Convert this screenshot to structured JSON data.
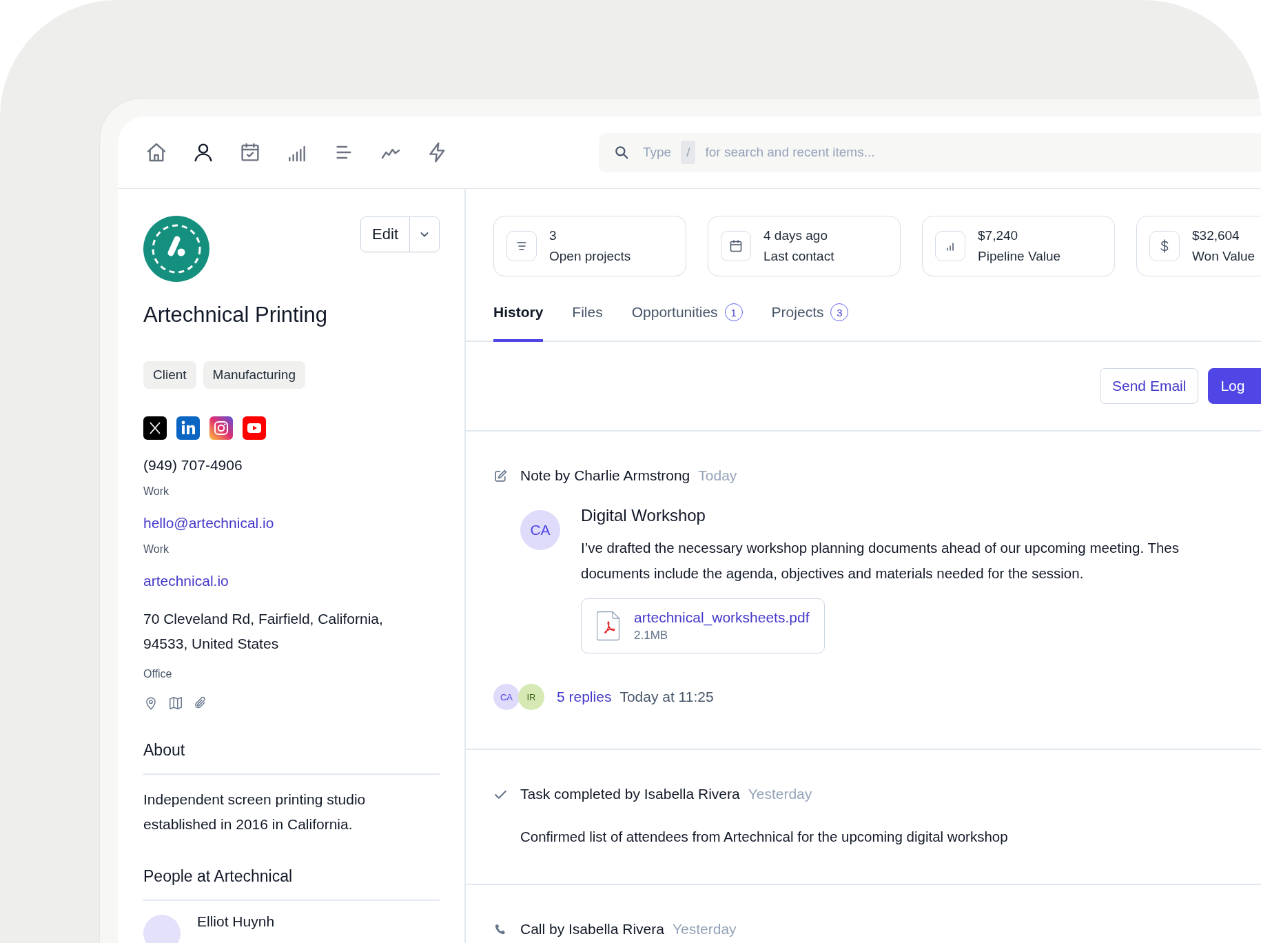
{
  "nav": {
    "items": [
      {
        "kind": "home",
        "selected": false
      },
      {
        "kind": "person",
        "selected": true
      },
      {
        "kind": "calendar",
        "selected": false
      },
      {
        "kind": "bars",
        "selected": false
      },
      {
        "kind": "lines",
        "selected": false
      },
      {
        "kind": "trend",
        "selected": false
      },
      {
        "kind": "bolt",
        "selected": false
      }
    ]
  },
  "search": {
    "hint": "Type",
    "shortcut": "/",
    "placeholder": "for search and recent items..."
  },
  "company": {
    "name": "Artechnical Printing",
    "edit_label": "Edit",
    "tags": [
      "Client",
      "Manufacturing"
    ],
    "social": [
      {
        "kind": "x"
      },
      {
        "kind": "linkedin"
      },
      {
        "kind": "instagram"
      },
      {
        "kind": "youtube"
      }
    ],
    "contacts": [
      {
        "kind": "phone",
        "value": "(949) 707-4906",
        "label": "Work"
      },
      {
        "kind": "email",
        "value": "hello@artechnical.io",
        "label": "Work"
      },
      {
        "kind": "website",
        "value": "artechnical.io"
      },
      {
        "kind": "address",
        "value": "70 Cleveland Rd, Fairfield, California, 94533, United States",
        "label": "Office"
      }
    ],
    "address_actions": [
      {
        "kind": "pin"
      },
      {
        "kind": "map"
      },
      {
        "kind": "clip"
      }
    ],
    "about": {
      "title": "About",
      "text": "Independent screen printing studio established in 2016 in California."
    },
    "people": {
      "title": "People at Artechnical",
      "items": [
        {
          "name": "Elliot Huynh"
        }
      ]
    }
  },
  "stats": [
    {
      "kind": "list",
      "value": "3",
      "label": "Open projects"
    },
    {
      "kind": "calendar",
      "value": "4 days ago",
      "label": "Last contact"
    },
    {
      "kind": "bars",
      "value": "$7,240",
      "label": "Pipeline Value"
    },
    {
      "kind": "dollar",
      "value": "$32,604",
      "label": "Won Value"
    }
  ],
  "tabs": [
    {
      "label": "History",
      "selected": true
    },
    {
      "label": "Files",
      "selected": false
    },
    {
      "label": "Opportunities",
      "count": "1",
      "selected": false
    },
    {
      "label": "Projects",
      "count": "3",
      "selected": false
    }
  ],
  "actions": [
    {
      "label": "Send Email",
      "kind": "secondary"
    },
    {
      "label": "Log",
      "kind": "primary"
    }
  ],
  "history": [
    {
      "kind": "note",
      "title": "Note by Charlie Armstrong",
      "time": "Today",
      "avatar": "CA",
      "heading": "Digital Workshop",
      "lines": [
        "I’ve drafted the necessary workshop planning documents ahead of our upcoming meeting. Thes",
        "documents include the agenda, objectives and materials needed for the session."
      ],
      "attachment": {
        "name": "artechnical_worksheets.pdf",
        "size": "2.1MB"
      },
      "reply_avatars": [
        {
          "initials": "CA",
          "color": "#dedbfb"
        },
        {
          "initials": "IR",
          "color": "#d6e9b4"
        }
      ],
      "replies": "5 replies",
      "reply_time": "Today at 11:25"
    },
    {
      "kind": "task",
      "title": "Task completed by Isabella Rivera",
      "time": "Yesterday",
      "text": "Confirmed list of attendees from Artechnical for the upcoming digital workshop"
    },
    {
      "kind": "call",
      "title": "Call by Isabella Rivera",
      "time": "Yesterday"
    }
  ]
}
